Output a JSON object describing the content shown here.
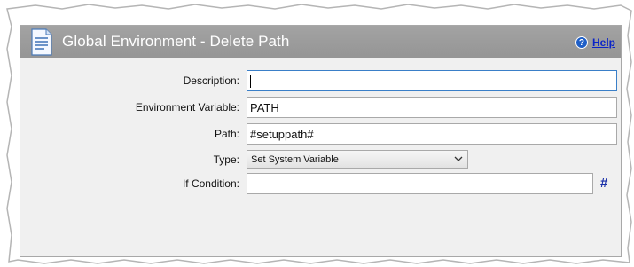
{
  "header": {
    "title": "Global Environment - Delete Path",
    "help_label": "Help",
    "icon": "document-icon",
    "help_icon_glyph": "?"
  },
  "form": {
    "description": {
      "label": "Description:",
      "value": ""
    },
    "env_var": {
      "label": "Environment Variable:",
      "value": "PATH"
    },
    "path": {
      "label": "Path:",
      "value": "#setuppath#"
    },
    "type": {
      "label": "Type:",
      "value": "Set System Variable"
    },
    "if_condition": {
      "label": "If Condition:",
      "value": "",
      "picker_glyph": "#"
    }
  },
  "colors": {
    "header_bg": "#9c9c9c",
    "panel_bg": "#f0f0f0",
    "help_link": "#0a24c8",
    "focus_border": "#3a7fc8",
    "hash_color": "#1a2fa8"
  }
}
